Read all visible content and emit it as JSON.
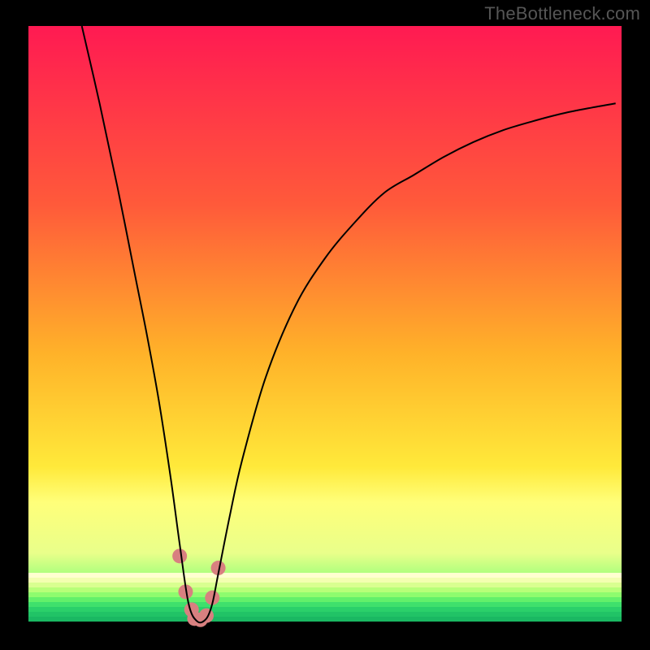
{
  "watermark": "TheBottleneck.com",
  "chart_data": {
    "type": "line",
    "title": "",
    "xlabel": "",
    "ylabel": "",
    "xlim": [
      0,
      100
    ],
    "ylim": [
      0,
      100
    ],
    "grid": false,
    "legend": false,
    "background": {
      "type": "vertical-gradient",
      "stops": [
        {
          "pos": 0.0,
          "color": "#ff1a52"
        },
        {
          "pos": 0.3,
          "color": "#ff5a3a"
        },
        {
          "pos": 0.55,
          "color": "#ffb229"
        },
        {
          "pos": 0.74,
          "color": "#ffe93a"
        },
        {
          "pos": 0.8,
          "color": "#ffff7a"
        },
        {
          "pos": 0.885,
          "color": "#e9ff8a"
        },
        {
          "pos": 0.93,
          "color": "#9cff7a"
        },
        {
          "pos": 0.97,
          "color": "#38e87a"
        },
        {
          "pos": 1.0,
          "color": "#1ecf6a"
        }
      ]
    },
    "annotations": {
      "green_floor_band": {
        "y_from": 97,
        "y_to": 100,
        "note": "multi-line green gradient zone at bottom"
      }
    },
    "series": [
      {
        "name": "bottleneck-curve",
        "color": "#000000",
        "stroke_width": 2,
        "x": [
          9,
          12,
          15,
          18,
          20,
          22,
          24,
          25.5,
          27,
          28.5,
          30,
          31,
          32,
          34,
          36,
          40,
          45,
          50,
          55,
          60,
          65,
          70,
          75,
          80,
          85,
          90,
          95,
          99
        ],
        "y": [
          100,
          87,
          73,
          58,
          48,
          37,
          24,
          13,
          3,
          0,
          0.5,
          3,
          8,
          18,
          27,
          41,
          53,
          61,
          67,
          72,
          75,
          78,
          80.5,
          82.5,
          84,
          85.3,
          86.3,
          87
        ]
      },
      {
        "name": "vertex-markers",
        "type": "scatter",
        "color": "#d88080",
        "marker_radius": 9,
        "x": [
          25.5,
          26.5,
          27.5,
          28,
          29,
          30,
          31,
          32
        ],
        "y": [
          11,
          5,
          2,
          0.5,
          0.3,
          1,
          4,
          9
        ]
      }
    ]
  }
}
